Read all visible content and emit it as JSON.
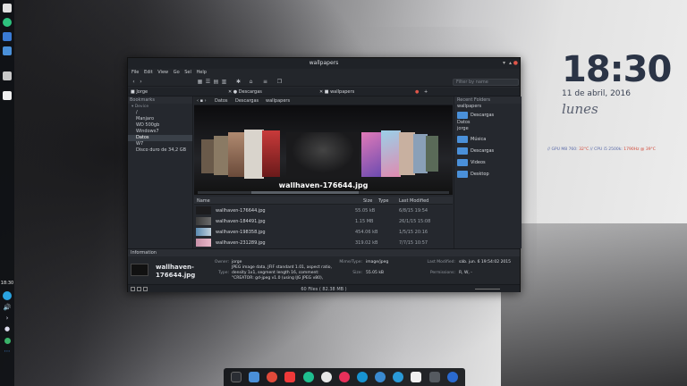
{
  "colors": {
    "folder": "#4a90d9",
    "accent_red": "#d24a3a"
  },
  "left_dock": {
    "time": "18:30"
  },
  "window": {
    "title": "wallpapers",
    "menu": [
      "File",
      "Edit",
      "View",
      "Go",
      "Sel",
      "Help"
    ],
    "search_placeholder": "Filter by name",
    "tab_left": "Jorge",
    "tab_middle": "Descargas",
    "tab_right": "wallpapers"
  },
  "sidebar": {
    "header": "Bookmarks",
    "sub": "Device",
    "items": [
      "/",
      "Manjaro",
      "WD 500gb",
      "Windows7",
      "Datos",
      "W7",
      "Disco duro de 34,2 GB"
    ],
    "selected_index": 4
  },
  "breadcrumb": {
    "parts": [
      "Datos",
      "Descargas",
      "wallpapers"
    ]
  },
  "coverflow": {
    "caption": "wallhaven-176644.jpg"
  },
  "list": {
    "columns": [
      "Name",
      "Size",
      "Type",
      "Last Modified"
    ],
    "rows": [
      {
        "name": "wallhaven-176644.jpg",
        "size": "55.05 kB",
        "date": "6/8/15 19:54"
      },
      {
        "name": "wallhaven-184491.jpg",
        "size": "1.15 MB",
        "date": "26/1/15 15:08"
      },
      {
        "name": "wallhaven-198358.jpg",
        "size": "454.06 kB",
        "date": "1/5/15 20:16"
      },
      {
        "name": "wallhaven-231289.jpg",
        "size": "319.02 kB",
        "date": "7/7/15 10:57"
      }
    ]
  },
  "recent": {
    "header": "Recent Folders",
    "group1": "wallpapers",
    "item1": "Descargas",
    "group2": "Datos",
    "group3": "jorge",
    "folders": [
      "Música",
      "Descargas",
      "Videos",
      "Desktop"
    ]
  },
  "info": {
    "header": "Information",
    "filename": "wallhaven-176644.jpg",
    "owner_label": "Owner:",
    "owner": "jorge",
    "type_label": "Type:",
    "type_lines": [
      "JPEG image data, JFIF standard 1.01, aspect ratio,",
      "density 1x1, segment length 16, comment:",
      "\"CREATOR: gd-jpeg v1.0 (using IJG JPEG v80),"
    ],
    "mime_label": "Mime/Type:",
    "mime": "image/jpeg",
    "size_label": "Size:",
    "size": "55.05 kB",
    "modified_label": "Last Modified:",
    "modified": "sáb. jun. 6 19:54:02 2015",
    "perm_label": "Permissions:",
    "perm": "R, W, -"
  },
  "status": "60 Files ( 82.38 MB )",
  "clock": {
    "time": "18:30",
    "date": "11 de abril, 2016",
    "day": "lunes"
  },
  "sysinfo": {
    "gpu": "// GPU M8 760: ",
    "gpu_temp": "32°C",
    "cpu": " // CPU i5 2500k: ",
    "cpu_freq": "1790Hz",
    "cpu_temp": " @ 39°C"
  },
  "dock_icons": [
    "terminal-icon",
    "files-icon",
    "pdf-icon",
    "vivaldi-icon",
    "music-icon",
    "inkscape-icon",
    "media-icon",
    "arch-icon",
    "wordpress-icon",
    "browser-icon",
    "dropbox-icon",
    "folder-icon",
    "app-icon"
  ]
}
